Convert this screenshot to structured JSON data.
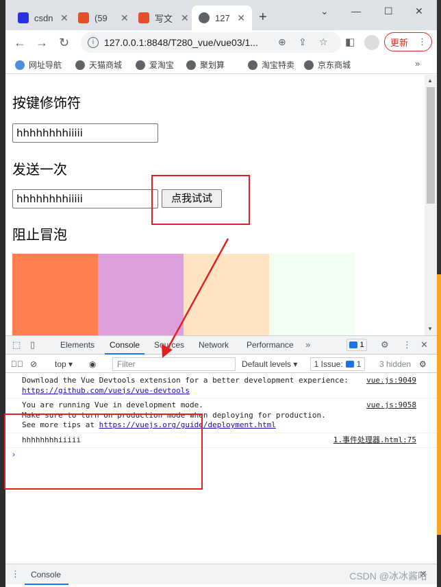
{
  "browser": {
    "tabs": [
      {
        "title": "csdn",
        "icon_color": "#2932e1"
      },
      {
        "title": "(59",
        "icon_color": "#e5502b"
      },
      {
        "title": "写文",
        "icon_color": "#e5502b"
      },
      {
        "title": "127",
        "icon_color": "#5f6368"
      }
    ],
    "url": "127.0.0.1:8848/T280_vue/vue03/1...",
    "update_label": "更新",
    "bookmarks": [
      "网址导航",
      "天猫商城",
      "爱淘宝",
      "聚划算",
      "淘宝特卖",
      "京东商城"
    ]
  },
  "page": {
    "heading1": "按键修饰符",
    "input1_value": "hhhhhhhhiiiii",
    "heading2": "发送一次",
    "input2_value": "hhhhhhhhiiiii",
    "button_label": "点我试试",
    "heading3": "阻止冒泡",
    "color_boxes": [
      "#ff7f50",
      "#dda0dd",
      "#ffe4c4",
      "#f0fff0"
    ]
  },
  "devtools": {
    "tabs": [
      "Elements",
      "Console",
      "Sources",
      "Network",
      "Performance"
    ],
    "active_tab": "Console",
    "issues_count": "1",
    "context": "top",
    "filter_placeholder": "Filter",
    "levels": "Default levels",
    "issue_pill": "1 Issue:",
    "issue_pill_count": "1",
    "hidden": "3 hidden",
    "messages": [
      {
        "line1": "Download the Vue Devtools extension for a better development experience:",
        "line2": "https://github.com/vuejs/vue-devtools",
        "source": "vue.js:9049"
      },
      {
        "line1": "You are running Vue in development mode.",
        "line2": "Make sure to turn on production mode when deploying for production.",
        "line3_prefix": "See more tips at ",
        "line3_link": "https://vuejs.org/guide/deployment.html",
        "source": "vue.js:9058"
      },
      {
        "line1": "hhhhhhhhiiiii",
        "source": "1.事件处理器.html:75"
      }
    ],
    "drawer_tab": "Console"
  },
  "watermark": "CSDN @冰冰酱哈"
}
